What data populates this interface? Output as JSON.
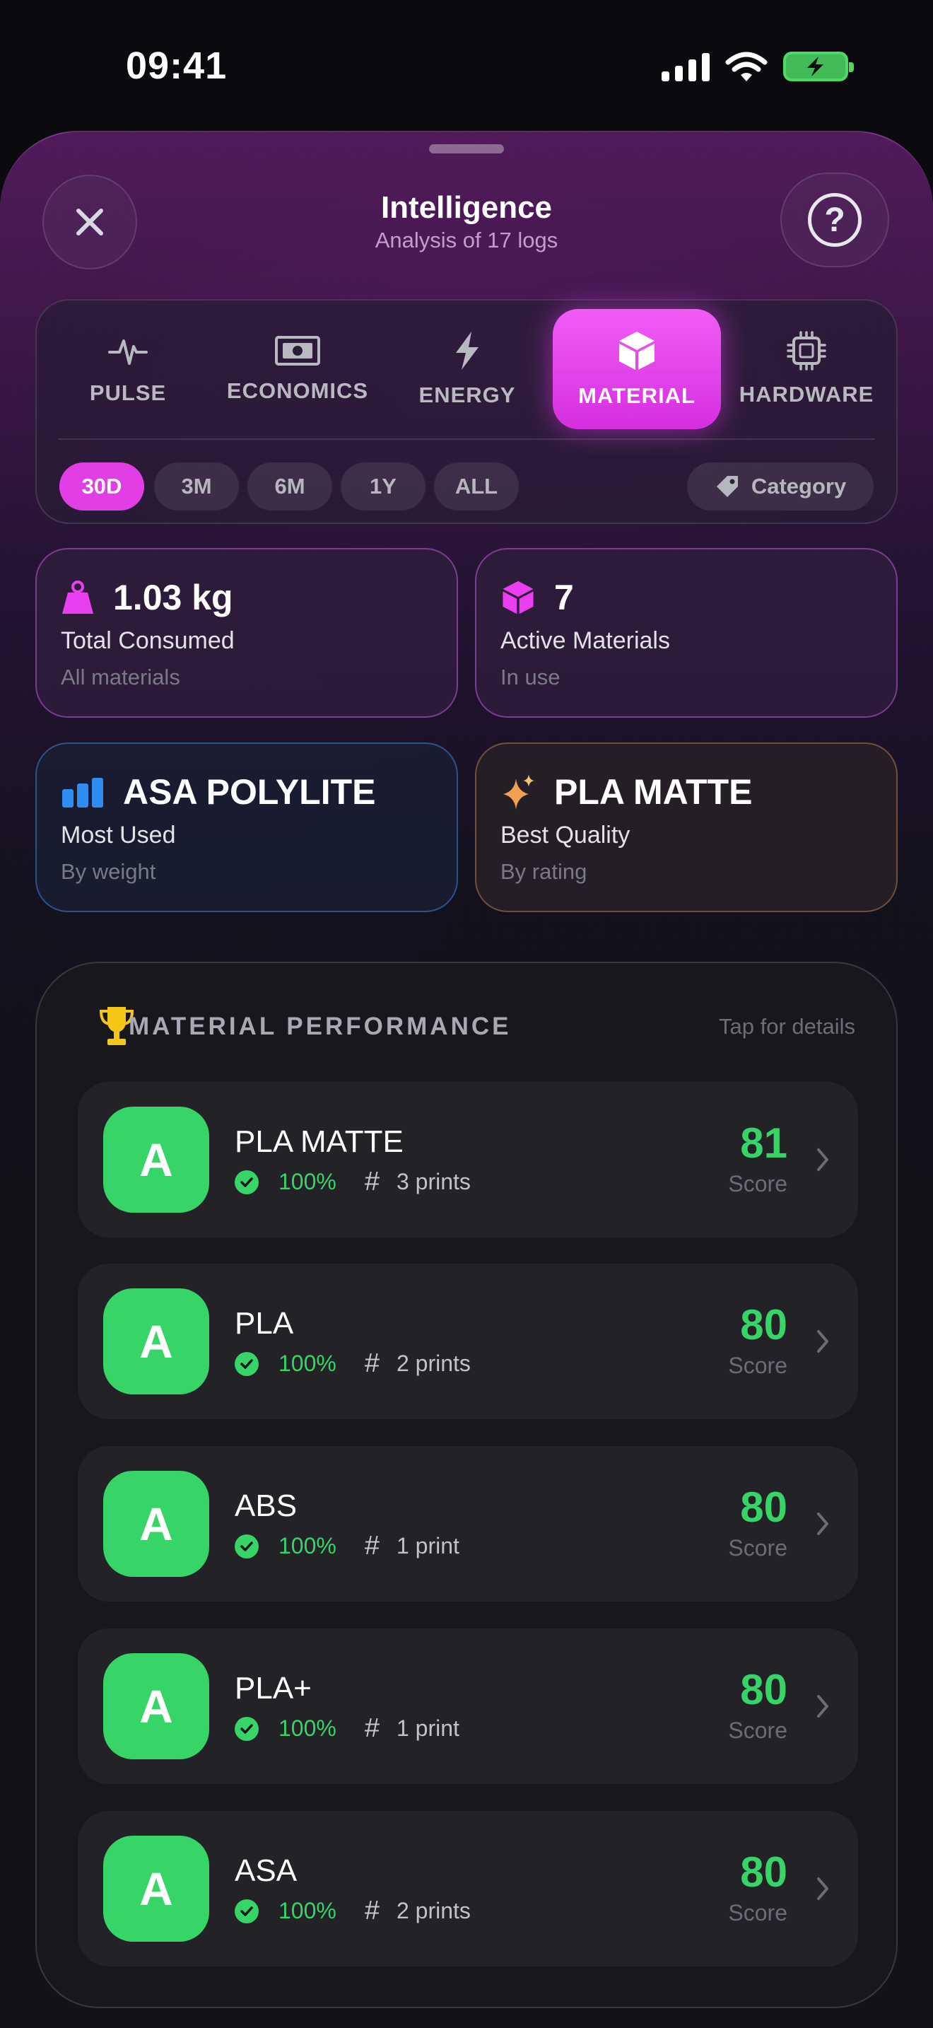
{
  "status": {
    "time": "09:41"
  },
  "header": {
    "title": "Intelligence",
    "subtitle": "Analysis of 17 logs"
  },
  "tabs": [
    {
      "label": "PULSE",
      "icon": "pulse-icon",
      "active": false
    },
    {
      "label": "ECONOMICS",
      "icon": "banknote-icon",
      "active": false
    },
    {
      "label": "ENERGY",
      "icon": "bolt-icon",
      "active": false
    },
    {
      "label": "MATERIAL",
      "icon": "cube-icon",
      "active": true
    },
    {
      "label": "HARDWARE",
      "icon": "chip-icon",
      "active": false
    }
  ],
  "ranges": [
    "30D",
    "3M",
    "6M",
    "1Y",
    "ALL"
  ],
  "selected_range": "30D",
  "category_label": "Category",
  "stats": [
    {
      "value": "1.03 kg",
      "label": "Total Consumed",
      "sub": "All materials",
      "icon": "weight-icon"
    },
    {
      "value": "7",
      "label": "Active Materials",
      "sub": "In use",
      "icon": "cube-icon"
    },
    {
      "value": "ASA POLYLITE",
      "label": "Most Used",
      "sub": "By weight",
      "icon": "bar-chart-icon"
    },
    {
      "value": "PLA MATTE",
      "label": "Best Quality",
      "sub": "By rating",
      "icon": "sparkles-icon"
    }
  ],
  "performance": {
    "title": "MATERIAL PERFORMANCE",
    "hint": "Tap for details",
    "score_label": "Score",
    "rows": [
      {
        "grade": "A",
        "name": "PLA MATTE",
        "success": "100%",
        "prints": "3 prints",
        "score": "81"
      },
      {
        "grade": "A",
        "name": "PLA",
        "success": "100%",
        "prints": "2 prints",
        "score": "80"
      },
      {
        "grade": "A",
        "name": "ABS",
        "success": "100%",
        "prints": "1 print",
        "score": "80"
      },
      {
        "grade": "A",
        "name": "PLA+",
        "success": "100%",
        "prints": "1 print",
        "score": "80"
      },
      {
        "grade": "A",
        "name": "ASA",
        "success": "100%",
        "prints": "2 prints",
        "score": "80"
      }
    ]
  },
  "colors": {
    "accent": "#e23ee6",
    "success": "#37d467",
    "blue": "#2f8cf0",
    "orange": "#f0a050"
  }
}
